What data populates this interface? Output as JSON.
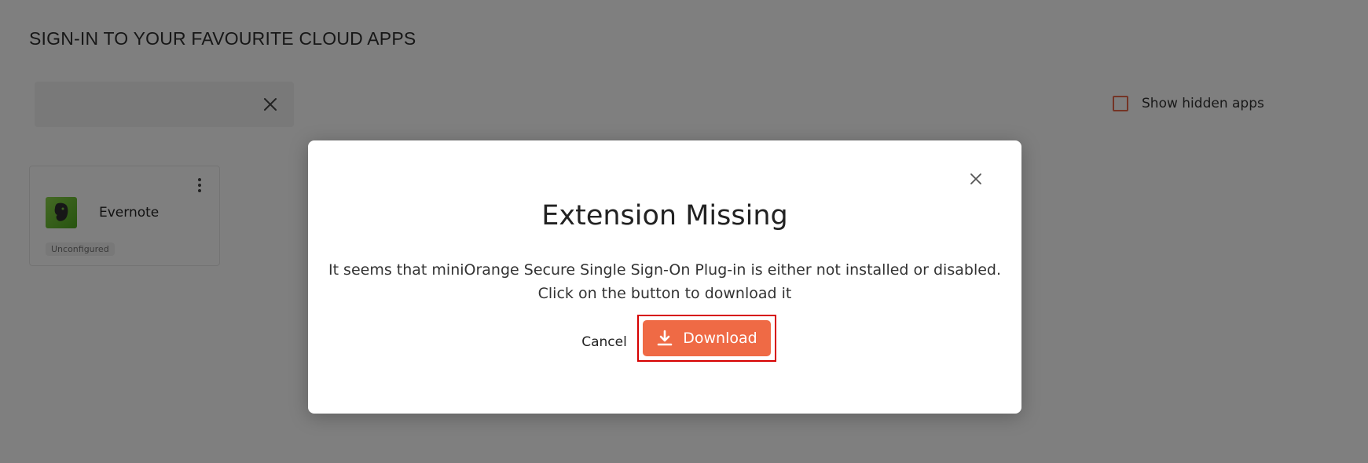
{
  "header": {
    "title": "SIGN-IN TO YOUR FAVOURITE CLOUD APPS"
  },
  "search": {
    "value": "",
    "placeholder": "",
    "clear_icon": "close-icon"
  },
  "filters": {
    "show_hidden_label": "Show hidden apps",
    "show_hidden_checked": false,
    "checkbox_color": "#e8684a"
  },
  "apps": [
    {
      "name": "Evernote",
      "status": "Unconfigured",
      "icon": "evernote-logo-icon",
      "menu_icon": "kebab-menu-icon"
    }
  ],
  "modal": {
    "title": "Extension Missing",
    "message_line1": "It seems that miniOrange Secure Single Sign-On Plug-in is either not installed or disabled.",
    "message_line2": "Click on the button to download it",
    "cancel_label": "Cancel",
    "download_label": "Download",
    "download_icon": "download-icon",
    "close_icon": "close-icon",
    "accent_color": "#ef6a45",
    "highlight_color": "#d60000"
  }
}
